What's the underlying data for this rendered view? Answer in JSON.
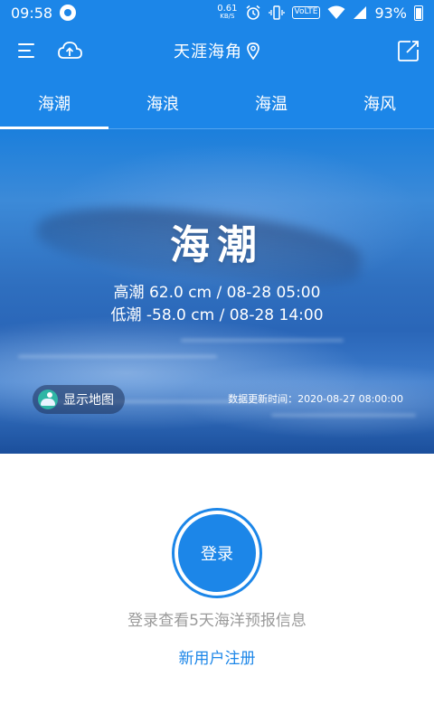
{
  "status_bar": {
    "time": "09:58",
    "net_speed": "0.61",
    "net_speed_unit": "KB/S",
    "volte": "VoLTE",
    "battery": "93%"
  },
  "app_bar": {
    "title": "天涯海角"
  },
  "tabs": [
    {
      "label": "海潮",
      "active": true
    },
    {
      "label": "海浪",
      "active": false
    },
    {
      "label": "海温",
      "active": false
    },
    {
      "label": "海风",
      "active": false
    }
  ],
  "hero": {
    "title": "海潮",
    "high_tide": "高潮 62.0 cm / 08-28 05:00",
    "low_tide": "低潮 -58.0 cm / 08-28 14:00",
    "map_button": "显示地图",
    "update_time": "数据更新时间：2020-08-27 08:00:00"
  },
  "account": {
    "login_button": "登录",
    "hint": "登录查看5天海洋预报信息",
    "register_link": "新用户注册"
  },
  "colors": {
    "primary": "#1c86e8",
    "hint_text": "#9a9a9a"
  }
}
